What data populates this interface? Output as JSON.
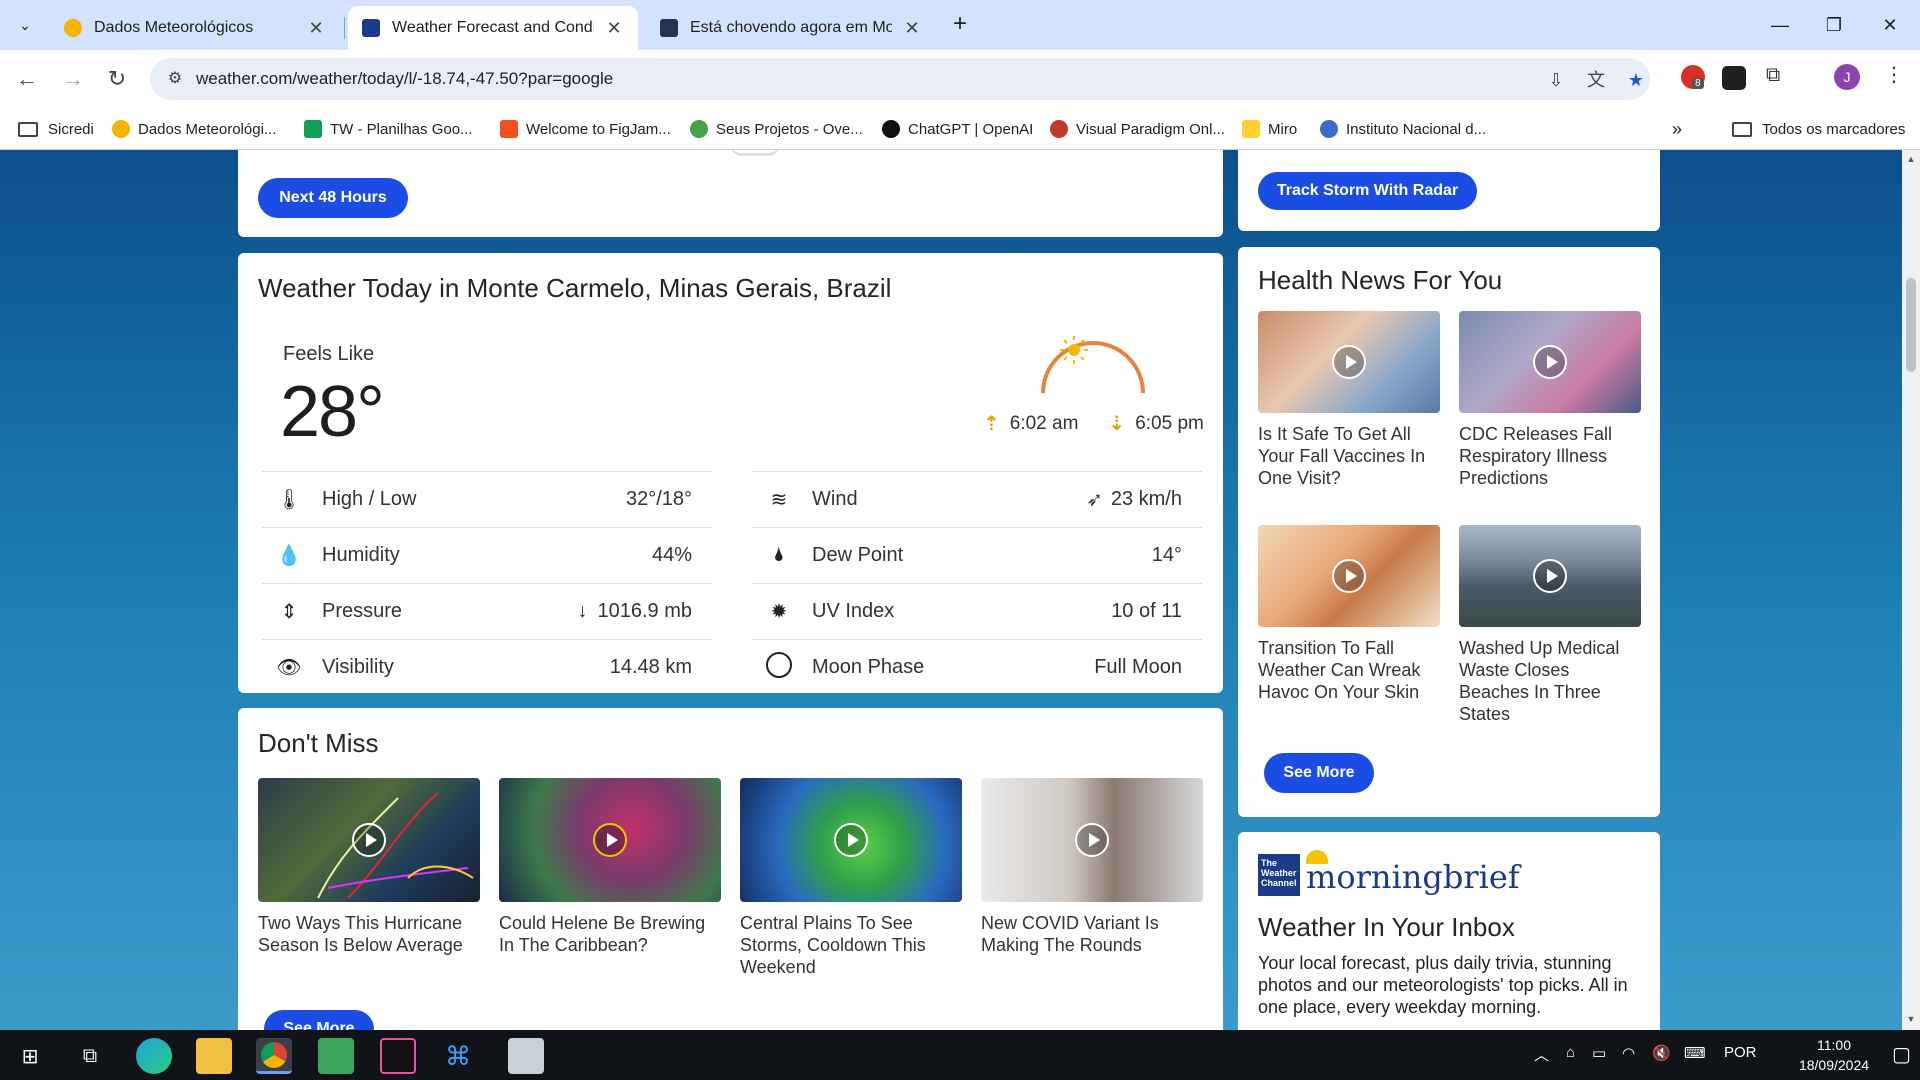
{
  "browser": {
    "tabs": [
      {
        "title": "Dados Meteorológicos",
        "active": false,
        "favicon_color": "#f4b400"
      },
      {
        "title": "Weather Forecast and Conditions",
        "active": true,
        "favicon_color": "#1a3a8a"
      },
      {
        "title": "Está chovendo agora em Monte Carmelo",
        "active": false,
        "favicon_color": "#223355"
      }
    ],
    "close_glyph": "✕",
    "new_tab_glyph": "+",
    "url": "weather.com/weather/today/l/-18.74,-47.50?par=google",
    "extension_badge": "8",
    "profile_initial": "J",
    "bookmarks": [
      {
        "label": "Sicredi",
        "type": "folder"
      },
      {
        "label": "Dados Meteorológi...",
        "icon_color": "#f4b400"
      },
      {
        "label": "TW - Planilhas Goo...",
        "icon_color": "#0f9d58"
      },
      {
        "label": "Welcome to FigJam...",
        "icon_color": "#f24e1e"
      },
      {
        "label": "Seus Projetos - Ove...",
        "icon_color": "#47a248"
      },
      {
        "label": "ChatGPT | OpenAI",
        "icon_color": "#111111"
      },
      {
        "label": "Visual Paradigm Onl...",
        "icon_color": "#c0392b"
      },
      {
        "label": "Miro",
        "icon_color": "#ffd02f"
      },
      {
        "label": "Instituto Nacional d...",
        "icon_color": "#3a6cc9"
      }
    ],
    "bookmarks_overflow": "»",
    "all_bookmarks": "Todos os marcadores"
  },
  "page": {
    "hourly_card": {
      "button": "Next 48 Hours"
    },
    "radar_card": {
      "button": "Track Storm With Radar"
    },
    "today": {
      "title": "Weather Today in Monte Carmelo, Minas Gerais, Brazil",
      "feels_like_label": "Feels Like",
      "feels_like_value": "28°",
      "sunrise": "6:02 am",
      "sunset": "6:05 pm",
      "left_details": [
        {
          "label": "High / Low",
          "value": "32°/18°",
          "icon": "thermometer-icon"
        },
        {
          "label": "Humidity",
          "value": "44%",
          "icon": "humidity-icon"
        },
        {
          "label": "Pressure",
          "value": "1016.9 mb",
          "icon": "pressure-icon"
        },
        {
          "label": "Visibility",
          "value": "14.48 km",
          "icon": "visibility-icon"
        }
      ],
      "right_details": [
        {
          "label": "Wind",
          "value": "23 km/h",
          "icon": "wind-icon"
        },
        {
          "label": "Dew Point",
          "value": "14°",
          "icon": "dew-point-icon"
        },
        {
          "label": "UV Index",
          "value": "10 of 11",
          "icon": "uv-index-icon"
        },
        {
          "label": "Moon Phase",
          "value": "Full Moon",
          "icon": "moon-phase-icon"
        }
      ]
    },
    "dont_miss": {
      "title": "Don't Miss",
      "items": [
        {
          "caption": "Two Ways This Hurricane Season Is Below Average"
        },
        {
          "caption": "Could Helene Be Brewing In The Caribbean?"
        },
        {
          "caption": "Central Plains To See Storms, Cooldown This Weekend"
        },
        {
          "caption": "New COVID Variant Is Making The Rounds"
        }
      ],
      "see_more": "See More"
    },
    "health_news": {
      "title": "Health News For You",
      "items": [
        {
          "caption": "Is It Safe To Get All Your Fall Vaccines In One Visit?"
        },
        {
          "caption": "CDC Releases Fall Respiratory Illness Predictions"
        },
        {
          "caption": "Transition To Fall Weather Can Wreak Havoc On Your Skin"
        },
        {
          "caption": "Washed Up Medical Waste Closes Beaches In Three States"
        }
      ],
      "see_more": "See More"
    },
    "newsletter": {
      "logo_text": "The Weather Channel",
      "brand": "morningbrief",
      "title": "Weather In Your Inbox",
      "body": "Your local forecast, plus daily trivia, stunning photos and our meteorologists' top picks. All in one place, every weekday morning."
    }
  },
  "taskbar": {
    "language": "POR",
    "time": "11:00",
    "date": "18/09/2024"
  }
}
